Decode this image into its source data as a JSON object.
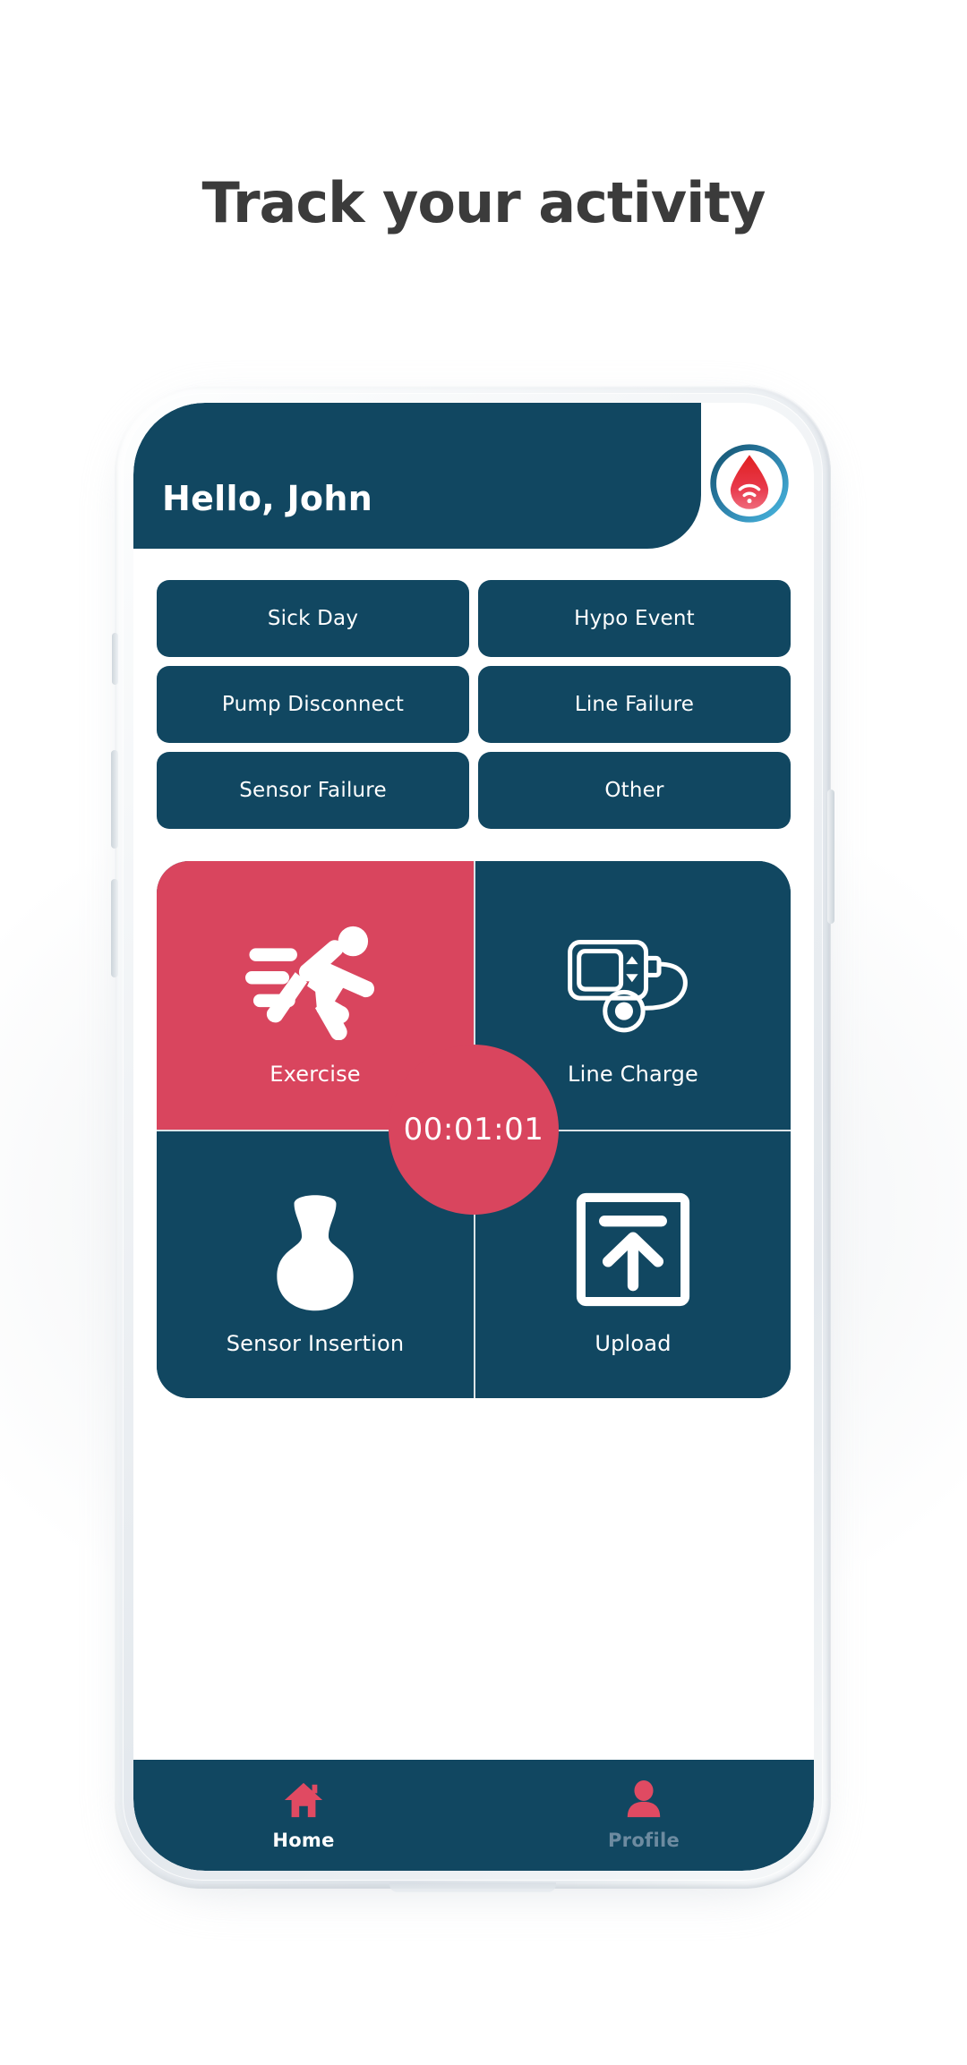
{
  "page": {
    "headline": "Track your activity",
    "background_color": "#ffffff"
  },
  "theme": {
    "navy": "#114761",
    "crimson": "#d9455e",
    "white": "#ffffff",
    "muted_label": "#6d8ba0",
    "headline_color": "#3b3b3b"
  },
  "app": {
    "header": {
      "greeting": "Hello, John",
      "logo_icon": "blood-drop-wifi-logo"
    },
    "event_buttons": [
      {
        "label": "Sick Day",
        "name": "sick-day"
      },
      {
        "label": "Hypo Event",
        "name": "hypo-event"
      },
      {
        "label": "Pump Disconnect",
        "name": "pump-disconnect"
      },
      {
        "label": "Line Failure",
        "name": "line-failure"
      },
      {
        "label": "Sensor Failure",
        "name": "sensor-failure"
      },
      {
        "label": "Other",
        "name": "other"
      }
    ],
    "activity_tiles": [
      {
        "label": "Exercise",
        "icon": "running-person-icon",
        "state": "active"
      },
      {
        "label": "Line Charge",
        "icon": "insulin-pump-icon",
        "state": "idle"
      },
      {
        "label": "Sensor Insertion",
        "icon": "sensor-applicator-icon",
        "state": "idle"
      },
      {
        "label": "Upload",
        "icon": "upload-arrow-icon",
        "state": "idle"
      }
    ],
    "timer": {
      "value": "00:01:01",
      "name": "exercise-timer"
    },
    "bottom_nav": [
      {
        "label": "Home",
        "icon": "home-icon",
        "state": "active"
      },
      {
        "label": "Profile",
        "icon": "person-icon",
        "state": "inactive"
      }
    ]
  }
}
